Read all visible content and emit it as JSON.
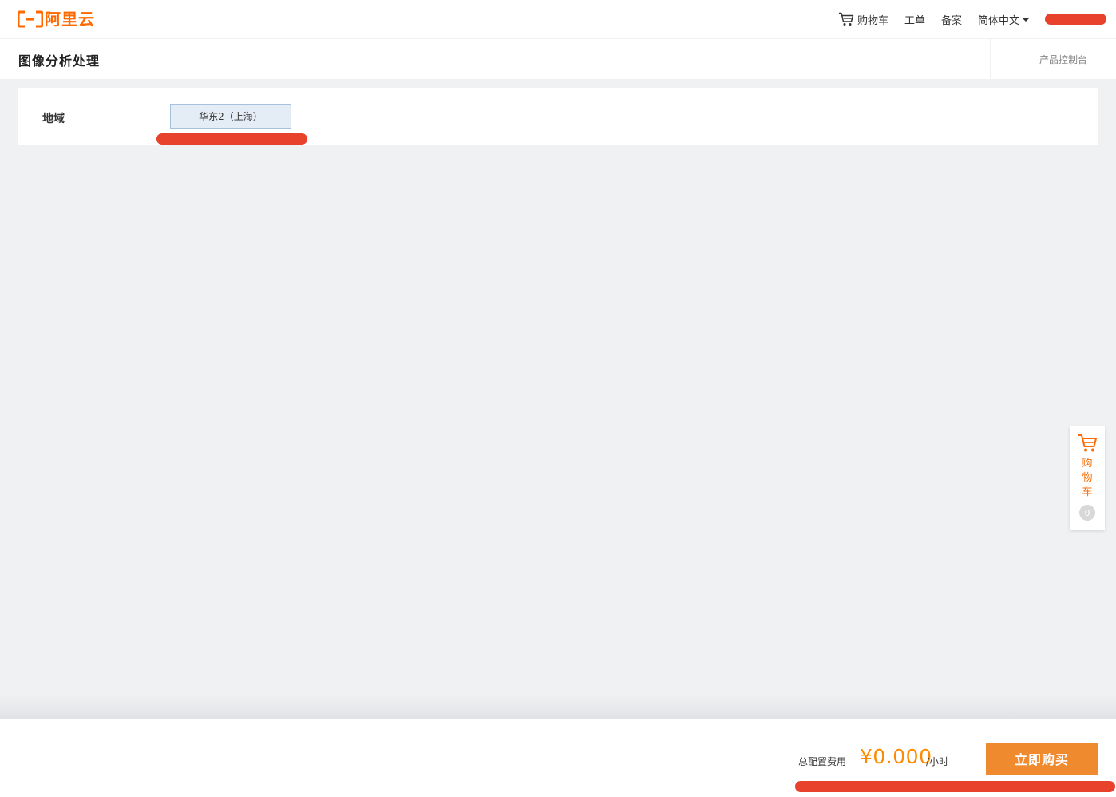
{
  "brand": {
    "name": "阿里云",
    "color": "#ff6a00"
  },
  "nav": {
    "cart": {
      "label": "购物车",
      "icon": "cart-icon"
    },
    "ticket": "工单",
    "filing": "备案",
    "language": "简体中文"
  },
  "page": {
    "title": "图像分析处理",
    "console_link": "产品控制台"
  },
  "region": {
    "label": "地域",
    "selected": "华东2（上海）"
  },
  "float_cart": {
    "label": "购物车",
    "count": "0",
    "icon": "cart-icon"
  },
  "footer": {
    "cost_label": "总配置费用",
    "cost_value": "¥0.000",
    "cost_unit": "/小时",
    "buy_label": "立即购买"
  },
  "colors": {
    "accent": "#ff6a00",
    "buy_button": "#f08a2e",
    "redaction": "#e8412c",
    "selected_bg": "#e4ecf6"
  }
}
